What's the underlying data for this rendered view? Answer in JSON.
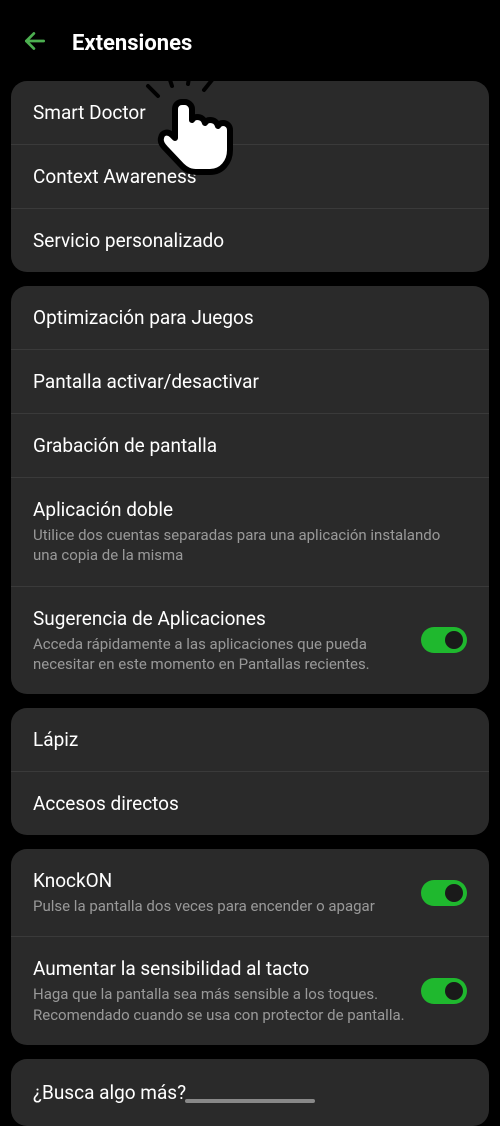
{
  "header": {
    "title": "Extensiones"
  },
  "groups": [
    {
      "items": [
        {
          "title": "Smart Doctor"
        },
        {
          "title": "Context Awareness"
        },
        {
          "title": "Servicio personalizado"
        }
      ]
    },
    {
      "items": [
        {
          "title": "Optimización para Juegos"
        },
        {
          "title": "Pantalla activar/desactivar"
        },
        {
          "title": "Grabación de pantalla"
        },
        {
          "title": "Aplicación doble",
          "subtitle": "Utilice dos cuentas separadas para una aplicación instalando una copia de la misma"
        },
        {
          "title": "Sugerencia de Aplicaciones",
          "subtitle": "Acceda rápidamente a las aplicaciones que pueda necesitar en este momento en Pantallas recientes.",
          "toggle": true
        }
      ]
    },
    {
      "items": [
        {
          "title": "Lápiz"
        },
        {
          "title": "Accesos directos"
        }
      ]
    },
    {
      "items": [
        {
          "title": "KnockON",
          "subtitle": "Pulse la pantalla dos veces para encender o apagar",
          "toggle": true
        },
        {
          "title": "Aumentar la sensibilidad al tacto",
          "subtitle": "Haga que la pantalla sea más sensible a los toques. Recomendado cuando se usa con protector de pantalla.",
          "toggle": true
        }
      ]
    }
  ],
  "footer": {
    "title": "¿Busca algo más?"
  }
}
